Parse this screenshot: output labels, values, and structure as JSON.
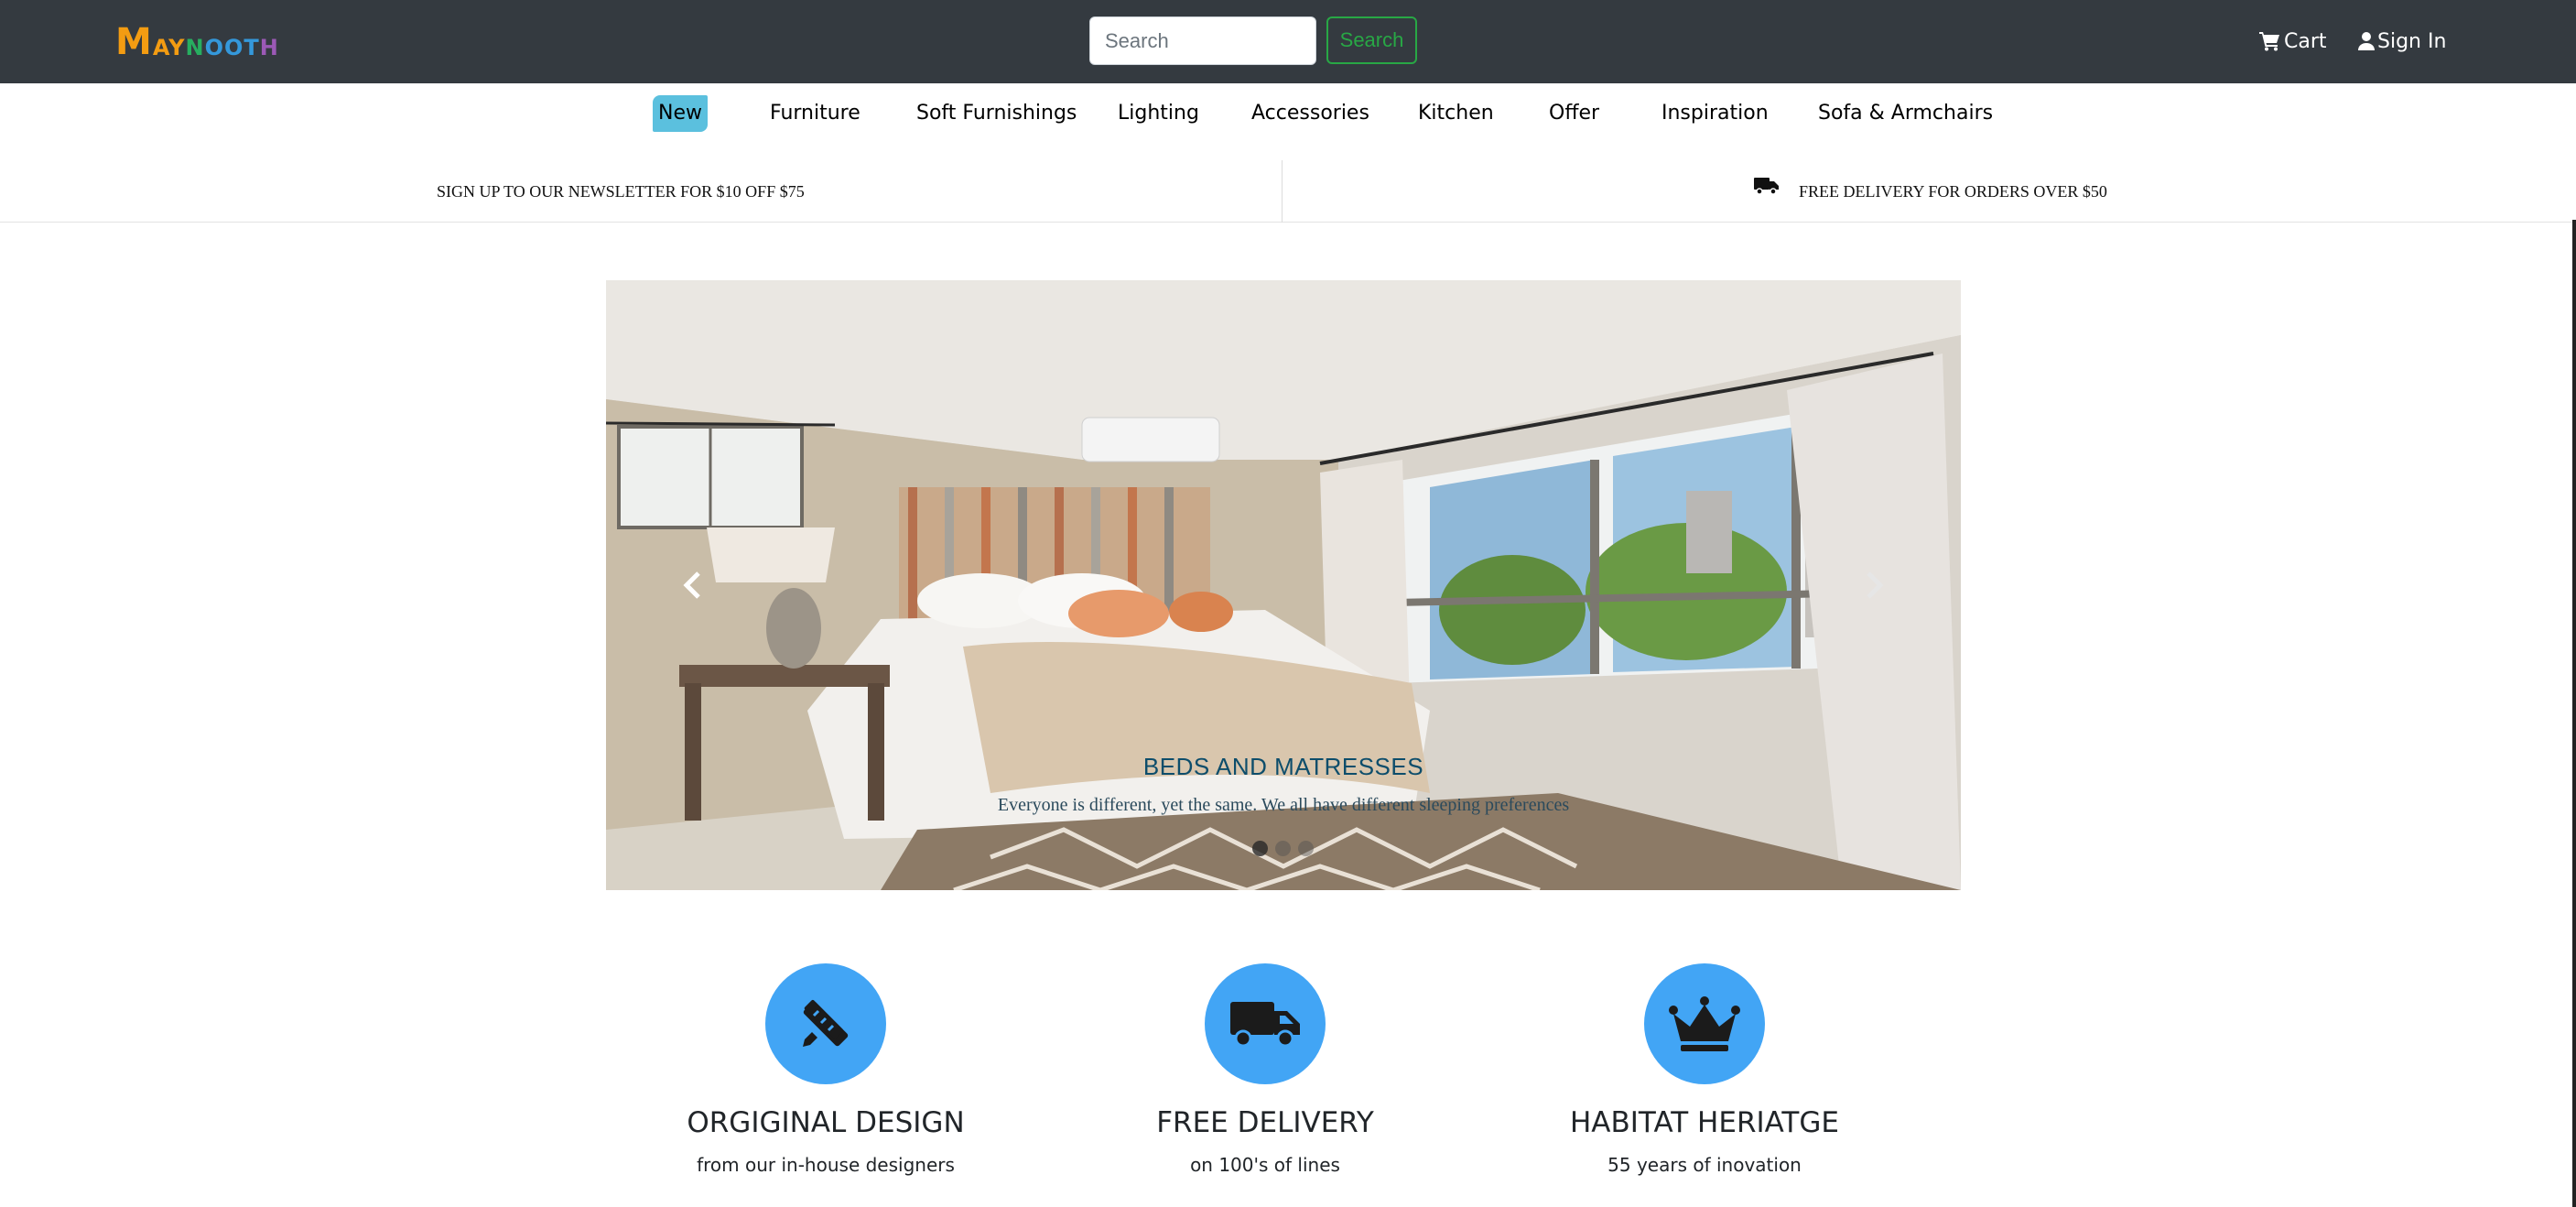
{
  "header": {
    "logo": {
      "letters": [
        "M",
        "AY",
        "N",
        "OOT",
        "H"
      ],
      "colors": [
        "#f39c12",
        "#f39c12",
        "#27ae60",
        "#3498db",
        "#9b59b6"
      ]
    },
    "search": {
      "placeholder": "Search",
      "button_label": "Search"
    },
    "cart_label": "Cart",
    "signin_label": "Sign In"
  },
  "nav": {
    "items": [
      "New",
      "Furniture",
      "Soft Furnishings",
      "Lighting",
      "Accessories",
      "Kitchen",
      "Offer",
      "Inspiration",
      "Sofa & Armchairs"
    ],
    "highlight_color": "#5bc0de"
  },
  "promo": {
    "left": "SIGN UP TO OUR NEWSLETTER FOR $10 OFF $75",
    "right": "FREE DELIVERY FOR ORDERS OVER $50"
  },
  "carousel": {
    "title": "BEDS AND MATRESSES",
    "subtitle": "Everyone is different, yet the same. We all have different sleeping preferences",
    "slide_count": 3,
    "active_slide": 1
  },
  "features": [
    {
      "icon": "pencil-ruler-icon",
      "title": "ORGIGINAL DESIGN",
      "subtitle": "from our in-house designers"
    },
    {
      "icon": "truck-icon",
      "title": "FREE DELIVERY",
      "subtitle": "on 100's of lines"
    },
    {
      "icon": "crown-icon",
      "title": "HABITAT HERIATGE",
      "subtitle": "55 years of inovation"
    }
  ],
  "colors": {
    "header_bg": "#343a40",
    "accent_green": "#28a745",
    "feature_blue": "#42a5f5"
  }
}
